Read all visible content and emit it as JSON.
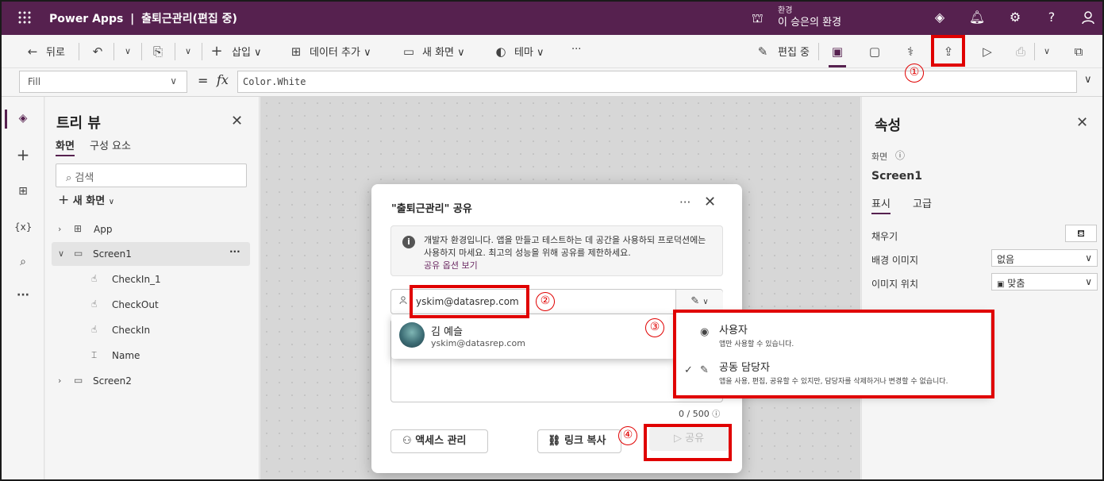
{
  "app": {
    "brand": "Power Apps",
    "separator": "|",
    "app_title": "출퇴근관리(편집 중)",
    "env_label": "환경",
    "env_name": "이 승은의 환경"
  },
  "commandbar": {
    "back": "뒤로",
    "insert": "삽입",
    "add_data": "데이터 추가",
    "new_screen": "새 화면",
    "theme": "테마",
    "more": "···",
    "editing": "편집 중"
  },
  "formula": {
    "property": "Fill",
    "equals": "=",
    "fx": "fx",
    "value": "Color.White"
  },
  "tree": {
    "title": "트리 뷰",
    "tab_screens": "화면",
    "tab_components": "구성 요소",
    "search_placeholder": "검색",
    "new_screen": "새 화면",
    "items": [
      {
        "label": "App"
      },
      {
        "label": "Screen1",
        "more": "···"
      },
      {
        "label": "CheckIn_1"
      },
      {
        "label": "CheckOut"
      },
      {
        "label": "CheckIn"
      },
      {
        "label": "Name"
      },
      {
        "label": "Screen2"
      }
    ]
  },
  "props": {
    "title": "속성",
    "section": "화면",
    "screen_name": "Screen1",
    "tab_display": "표시",
    "tab_advanced": "고급",
    "fill_label": "채우기",
    "bg_image_label": "배경 이미지",
    "bg_image_value": "없음",
    "image_pos_label": "이미지 위치",
    "image_pos_value": "맞춤"
  },
  "dialog": {
    "title": "\"출퇴근관리\" 공유",
    "more": "···",
    "info_text": "개발자 환경입니다. 앱을 만들고 테스트하는 데 공간을 사용하되 프로덕션에는 사용하지 마세요. 최고의 성능을 위해 공유를 제한하세요.",
    "info_link": "공유 옵션 보기",
    "share_value": "yskim@datasrep.com",
    "counter": "0 / 500",
    "manage_access": "액세스 관리",
    "copy_link": "링크 복사",
    "share": "공유"
  },
  "suggestion": {
    "name": "김 예슬",
    "email": "yskim@datasrep.com"
  },
  "perm_menu": {
    "user_title": "사용자",
    "user_desc": "앱만 사용할 수 있습니다.",
    "coowner_title": "공동 담당자",
    "coowner_desc": "앱을 사용, 편집, 공유할 수 있지만, 담당자를 삭제하거나 변경할 수 없습니다."
  },
  "steps": [
    "①",
    "②",
    "③",
    "④"
  ],
  "colors": {
    "topbar": "#56214f",
    "highlight": "#e00000",
    "link": "#6b2a63"
  }
}
